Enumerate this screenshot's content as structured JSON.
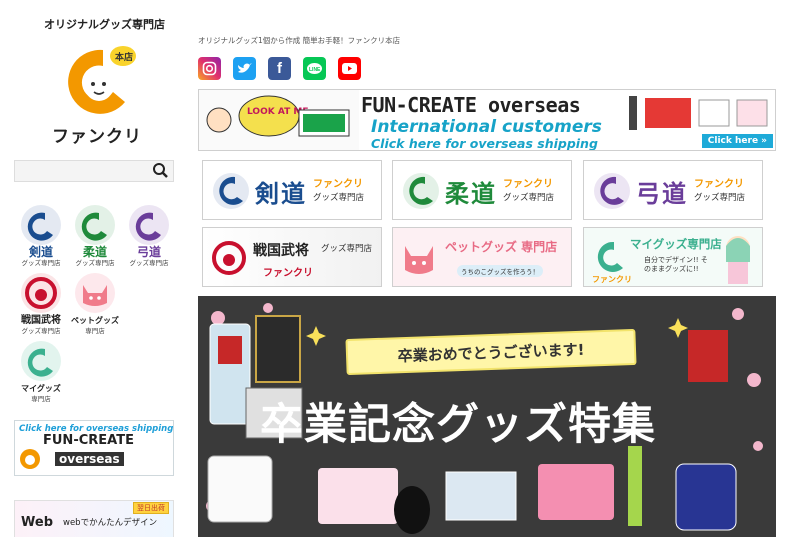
{
  "header": {
    "logo_tagline": "オリジナルグッズ専門店",
    "logo_badge": "本店",
    "logo_wordmark": "ファンクリ",
    "site_tagline": "オリジナルグッズ1個から作成 簡単お手軽！ファンクリ本店"
  },
  "search": {
    "placeholder": "",
    "icon": "search-icon"
  },
  "socials": [
    {
      "name": "instagram",
      "color": "#e1306c"
    },
    {
      "name": "twitter",
      "color": "#1da1f2"
    },
    {
      "name": "facebook",
      "color": "#3b5998"
    },
    {
      "name": "line",
      "color": "#06c755"
    },
    {
      "name": "youtube",
      "color": "#ff0000"
    }
  ],
  "sidebar": {
    "categories": [
      {
        "big": "剣道",
        "small": "グッズ専門店",
        "color": "#1a4d8f"
      },
      {
        "big": "柔道",
        "small": "グッズ専門店",
        "color": "#1f8a3b"
      },
      {
        "big": "弓道",
        "small": "グッズ専門店",
        "color": "#6a3d9a"
      },
      {
        "big": "戦国武将",
        "small": "グッズ専門店",
        "color": "#c8102e"
      },
      {
        "big": "ペットグッズ",
        "small": "専門店",
        "color": "#f07b8a"
      },
      {
        "big": "マイグッズ",
        "small": "専門店",
        "color": "#3bb08f"
      }
    ],
    "overseas_banner": {
      "top": "Click here for overseas shipping",
      "main": "FUN-CREATE",
      "sub": "overseas"
    },
    "web_banner": {
      "web": "Web",
      "text": "webでかんたんデザイン",
      "badge": "翌日出荷"
    }
  },
  "overseas_banner": {
    "title": "FUN-CREATE overseas",
    "line2": "International customers",
    "line3": "Click here for overseas shipping",
    "cta": "Click here »",
    "sticker": "LOOK AT ME"
  },
  "store_banners": [
    {
      "kanji": "剣道",
      "brand": "ファンクリ",
      "sub": "グッズ専門店",
      "color": "#1a4d8f"
    },
    {
      "kanji": "柔道",
      "brand": "ファンクリ",
      "sub": "グッズ専門店",
      "color": "#1f8a3b"
    },
    {
      "kanji": "弓道",
      "brand": "ファンクリ",
      "sub": "グッズ専門店",
      "color": "#6a3d9a"
    },
    {
      "kanji": "戦国武将",
      "brand": "ファンクリ",
      "sub": "グッズ専門店",
      "color": "#c8102e"
    },
    {
      "kanji": "ペットグッズ 専門店",
      "brand": "",
      "sub": "うちのこグッズを作ろう！",
      "color": "#e86a84"
    },
    {
      "kanji": "マイグッズ専門店",
      "brand": "ファンクリ",
      "sub": "自分でデザイン!! そのままグッズに!!",
      "color": "#3bb08f"
    }
  ],
  "hero": {
    "ribbon": "卒業おめでとうございます!",
    "title": "卒業記念グッズ特集"
  }
}
